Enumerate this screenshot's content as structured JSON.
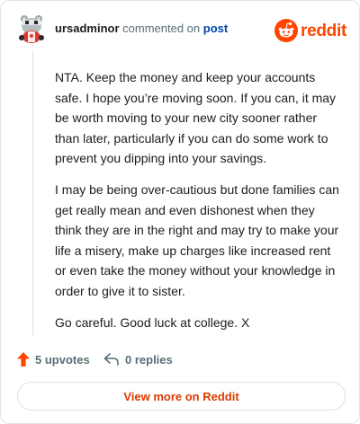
{
  "header": {
    "username": "ursadminor",
    "commented_text": "commented on",
    "post_link": "post",
    "brand": "reddit"
  },
  "comment": {
    "paragraphs": [
      "NTA. Keep the money and keep your accounts safe. I hope you’re moving soon. If you can, it may be worth moving to your new city sooner rather than later, particularly if you can do some work to prevent you dipping into your savings.",
      "I may be being over-cautious but done families can get really mean and even dishonest when they think they are in the right and may try to make your life a misery, make up charges like increased rent or even take the money without your knowledge in order to give it to sister.",
      "Go careful. Good luck at college. X"
    ]
  },
  "actions": {
    "upvotes": "5 upvotes",
    "replies": "0 replies"
  },
  "footer": {
    "view_more": "View more on Reddit"
  },
  "colors": {
    "brand": "#ff4500",
    "link": "#0045ac",
    "muted": "#576f76",
    "view_more": "#d93a00"
  },
  "icons": {
    "avatar": "snoo-avatar-icon",
    "brand": "reddit-logo-icon",
    "upvote": "upvote-arrow-icon",
    "reply": "reply-arrow-icon"
  }
}
